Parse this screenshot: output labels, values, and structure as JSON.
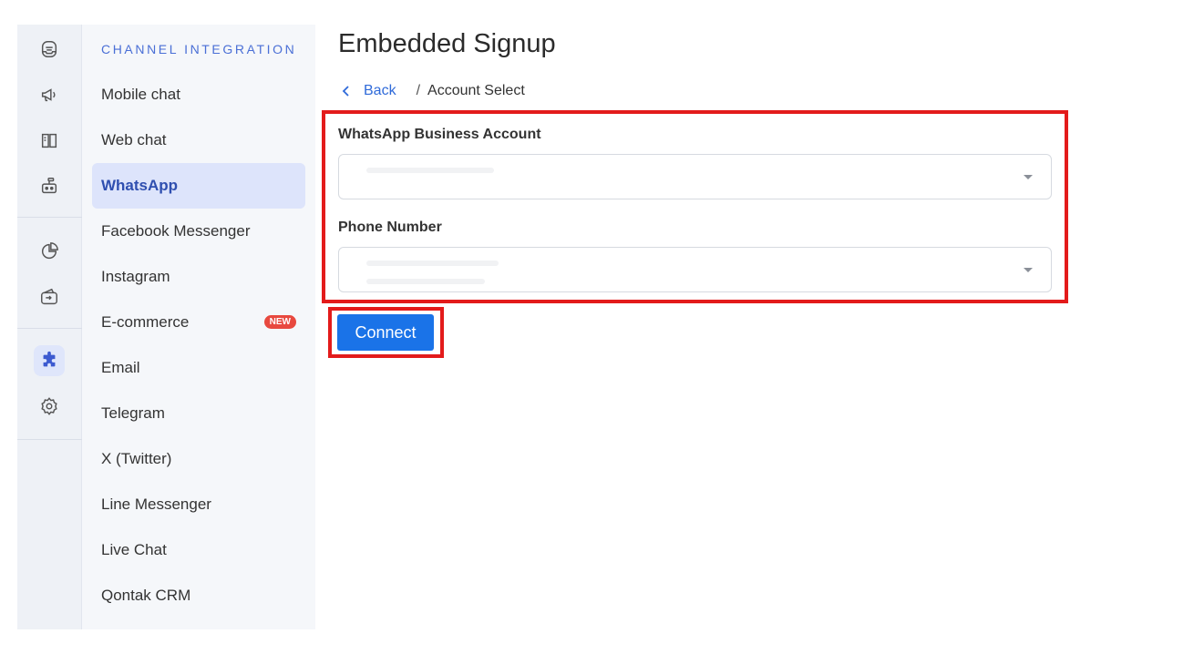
{
  "sidebar": {
    "heading": "CHANNEL INTEGRATION",
    "items": [
      {
        "label": "Mobile chat"
      },
      {
        "label": "Web chat"
      },
      {
        "label": "WhatsApp",
        "active": true
      },
      {
        "label": "Facebook Messenger"
      },
      {
        "label": "Instagram"
      },
      {
        "label": "E-commerce",
        "badge": "NEW"
      },
      {
        "label": "Email"
      },
      {
        "label": "Telegram"
      },
      {
        "label": "X (Twitter)"
      },
      {
        "label": "Line Messenger"
      },
      {
        "label": "Live Chat"
      },
      {
        "label": "Qontak CRM"
      }
    ]
  },
  "rail": {
    "icons": [
      "inbox-icon",
      "megaphone-icon",
      "book-icon",
      "bot-icon",
      "pie-chart-icon",
      "wallet-icon",
      "puzzle-icon",
      "gear-icon"
    ],
    "active": "puzzle-icon"
  },
  "main": {
    "title": "Embedded Signup",
    "breadcrumb": {
      "back_label": "Back",
      "separator": "/",
      "current": "Account Select"
    },
    "form": {
      "waba_label": "WhatsApp Business Account",
      "waba_value": "",
      "phone_label": "Phone Number",
      "phone_value": ""
    },
    "connect_label": "Connect"
  },
  "colors": {
    "accent": "#1a73e8",
    "highlight": "#e31b1b",
    "menu_active_bg": "#dde4fb",
    "badge": "#e8493f"
  }
}
